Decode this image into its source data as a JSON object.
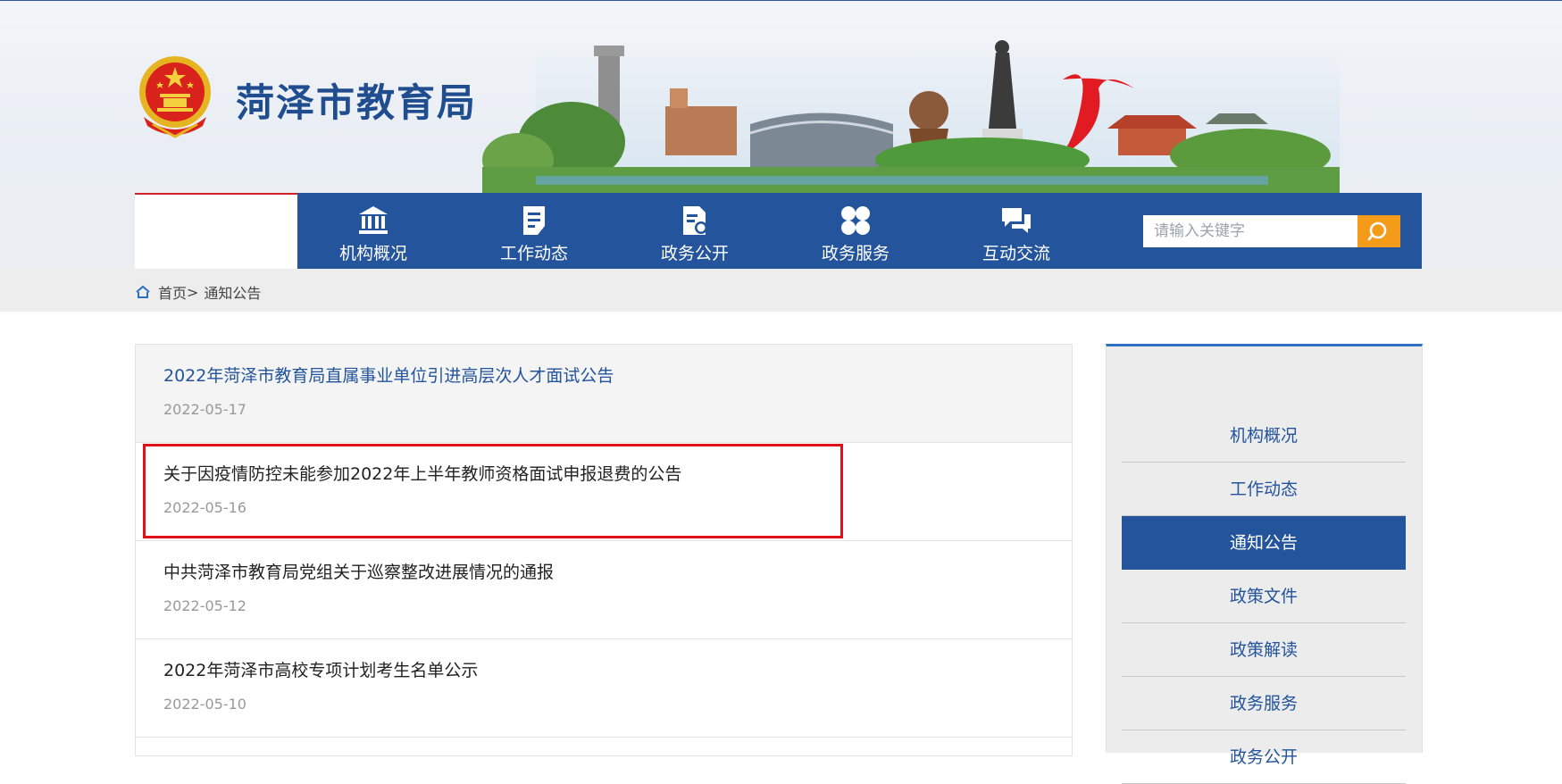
{
  "header": {
    "site_title": "菏泽市教育局"
  },
  "nav": {
    "items": [
      {
        "label": "机构概况",
        "icon": "institution-icon"
      },
      {
        "label": "工作动态",
        "icon": "document-icon"
      },
      {
        "label": "政务公开",
        "icon": "file-search-icon"
      },
      {
        "label": "政务服务",
        "icon": "clover-icon"
      },
      {
        "label": "互动交流",
        "icon": "chat-icon"
      }
    ],
    "search": {
      "placeholder": "请输入关键字",
      "icon": "search-icon"
    }
  },
  "breadcrumb": {
    "home": "首页",
    "separator": ">",
    "current": "通知公告"
  },
  "list": {
    "items": [
      {
        "title": "2022年菏泽市教育局直属事业单位引进高层次人才面试公告",
        "date": "2022-05-17"
      },
      {
        "title": "关于因疫情防控未能参加2022年上半年教师资格面试申报退费的公告",
        "date": "2022-05-16"
      },
      {
        "title": "中共菏泽市教育局党组关于巡察整改进展情况的通报",
        "date": "2022-05-12"
      },
      {
        "title": "2022年菏泽市高校专项计划考生名单公示",
        "date": "2022-05-10"
      }
    ]
  },
  "sidebar": {
    "items": [
      {
        "label": "机构概况"
      },
      {
        "label": "工作动态"
      },
      {
        "label": "通知公告",
        "active": true
      },
      {
        "label": "政策文件"
      },
      {
        "label": "政策解读"
      },
      {
        "label": "政务服务"
      },
      {
        "label": "政务公开"
      }
    ]
  },
  "colors": {
    "brand_blue": "#23549c",
    "accent_orange": "#f59b1a",
    "highlight_red": "#e01019"
  }
}
